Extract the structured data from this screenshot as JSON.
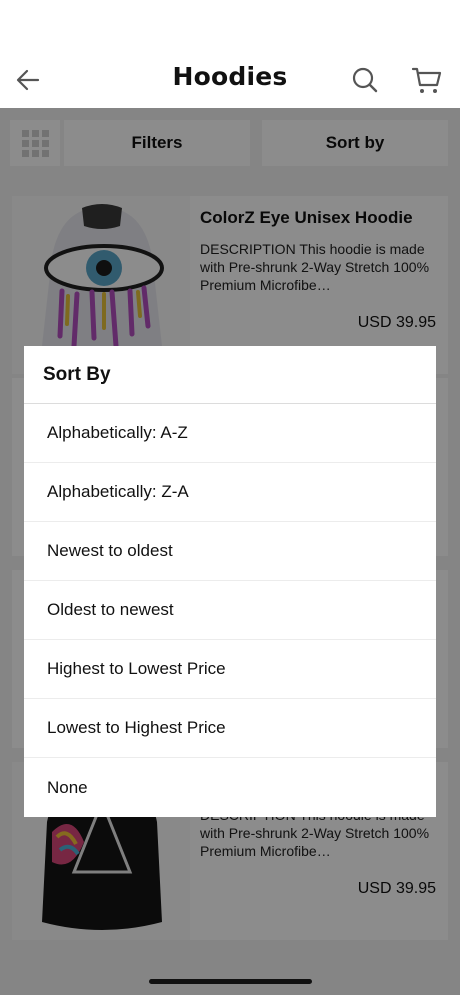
{
  "header": {
    "title": "Hoodies",
    "back_icon": "arrow-left-icon",
    "search_icon": "search-icon",
    "cart_icon": "cart-icon"
  },
  "toolbar": {
    "grid_icon": "grid-view-icon",
    "filters_label": "Filters",
    "sort_label": "Sort by"
  },
  "products": [
    {
      "name": "ColorZ Eye Unisex Hoodie",
      "description": "DESCRIPTION This hoodie is made with Pre-shrunk 2-Way Stretch 100% Premium Microfibe…",
      "price": "USD 39.95"
    },
    {
      "name": "",
      "description": "DESCRIPTION This hoodie is made with Pre-shrunk 2-Way Stretch 100% Premium Microfibe…",
      "price": "USD 39.95"
    }
  ],
  "sort_sheet": {
    "title": "Sort By",
    "options": [
      "Alphabetically: A-Z",
      "Alphabetically: Z-A",
      "Newest to oldest",
      "Oldest to newest",
      "Highest to Lowest Price",
      "Lowest to Highest Price",
      "None"
    ]
  },
  "colors": {
    "overlay": "#000000",
    "background": "#f2f2f2"
  }
}
